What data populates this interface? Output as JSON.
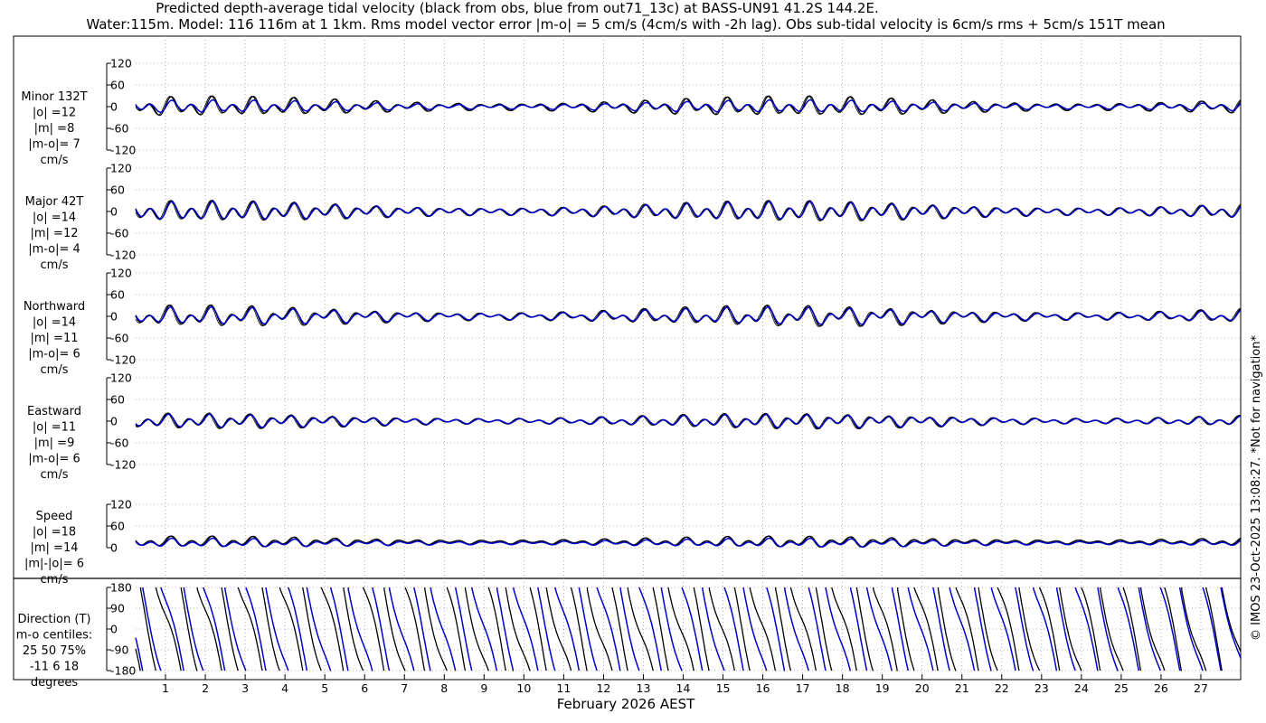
{
  "title_line1": "Predicted depth-average tidal velocity (black from obs, blue from out71_13c) at BASS-UN91 41.2S 144.2E.",
  "title_line2": "Water:115m. Model: 116 116m at 1 1km. Rms model vector error |m-o| = 5 cm/s (4cm/s with -2h lag). Obs sub-tidal velocity is 6cm/s rms + 5cm/s 151T mean",
  "copyright": "© IMOS 23-Oct-2025 13:08:27. *Not for navigation*",
  "colors": {
    "obs": "#000000",
    "model": "#0000cc",
    "grid": "#999999"
  },
  "chart_data": {
    "type": "line",
    "xlabel": "February 2026 AEST",
    "x_ticks": [
      "1",
      "2",
      "3",
      "4",
      "5",
      "6",
      "7",
      "8",
      "9",
      "10",
      "11",
      "12",
      "13",
      "14",
      "15",
      "16",
      "17",
      "18",
      "19",
      "20",
      "21",
      "22",
      "23",
      "24",
      "25",
      "26",
      "27"
    ],
    "xlim": [
      0.25,
      28.0
    ],
    "series_legend": [
      "obs (black)",
      "model (blue)"
    ],
    "panels": [
      {
        "id": "minor",
        "labels": [
          "Minor 132T",
          "|o| =12",
          "|m| =8",
          "|m-o|= 7",
          "cm/s"
        ],
        "yticks": [
          "120",
          "60",
          "0",
          "-60",
          "-120"
        ],
        "ylim": [
          -120,
          120
        ],
        "obs": {
          "mean": 0,
          "semidiurnal_amp": 16,
          "diurnal_amp": 11,
          "sd_phase": 0.4,
          "d_phase": 0.2
        },
        "model": {
          "mean": 0,
          "semidiurnal_amp": 11,
          "diurnal_amp": 6,
          "sd_phase": 0.2,
          "d_phase": 0.1
        }
      },
      {
        "id": "major",
        "labels": [
          "Major 42T",
          "|o| =14",
          "|m| =12",
          "|m-o|= 4",
          "cm/s"
        ],
        "yticks": [
          "120",
          "60",
          "0",
          "-60",
          "-120"
        ],
        "ylim": [
          -120,
          120
        ],
        "obs": {
          "mean": 0,
          "semidiurnal_amp": 18,
          "diurnal_amp": 10,
          "sd_phase": 0.3,
          "d_phase": 0.5
        },
        "model": {
          "mean": 0,
          "semidiurnal_amp": 16,
          "diurnal_amp": 9,
          "sd_phase": 0.15,
          "d_phase": 0.4
        }
      },
      {
        "id": "northward",
        "labels": [
          "Northward",
          "|o| =14",
          "|m| =11",
          "|m-o|= 6",
          "cm/s"
        ],
        "yticks": [
          "120",
          "60",
          "0",
          "-60",
          "-120"
        ],
        "ylim": [
          -120,
          120
        ],
        "obs": {
          "mean": 0,
          "semidiurnal_amp": 16,
          "diurnal_amp": 13,
          "sd_phase": 0.6,
          "d_phase": 0.9
        },
        "model": {
          "mean": 0,
          "semidiurnal_amp": 13,
          "diurnal_amp": 11,
          "sd_phase": 0.45,
          "d_phase": 0.8
        }
      },
      {
        "id": "eastward",
        "labels": [
          "Eastward",
          "|o| =11",
          "|m| =9",
          "|m-o|= 6",
          "cm/s"
        ],
        "yticks": [
          "120",
          "60",
          "0",
          "-60",
          "-120"
        ],
        "ylim": [
          -120,
          120
        ],
        "obs": {
          "mean": 0,
          "semidiurnal_amp": 13,
          "diurnal_amp": 8,
          "sd_phase": 1.1,
          "d_phase": 1.4
        },
        "model": {
          "mean": 0,
          "semidiurnal_amp": 11,
          "diurnal_amp": 7,
          "sd_phase": 0.95,
          "d_phase": 1.3
        }
      },
      {
        "id": "speed",
        "labels": [
          "Speed",
          "|o| =18",
          "|m| =14",
          "|m|-|o|= 6",
          "cm/s"
        ],
        "yticks": [
          "120",
          "60",
          "0"
        ],
        "ylim": [
          0,
          120
        ],
        "obs": {
          "mean": 16,
          "semidiurnal_amp": 9,
          "diurnal_amp": 6,
          "sd_phase": 0.2,
          "d_phase": 0.6
        },
        "model": {
          "mean": 13,
          "semidiurnal_amp": 7,
          "diurnal_amp": 5,
          "sd_phase": 0.1,
          "d_phase": 0.5
        }
      },
      {
        "id": "direction",
        "labels": [
          "Direction (T)",
          "m-o centiles:",
          "25  50  75%",
          "-11   6  18",
          "degrees"
        ],
        "yticks": [
          "180",
          "90",
          "0",
          "-90",
          "-180"
        ],
        "ylim": [
          -180,
          180
        ],
        "obs": {
          "start": 40,
          "rate_deg_per_day": -700,
          "wobble": 50
        },
        "model": {
          "start": 95,
          "rate_deg_per_day": -690,
          "wobble": 40
        }
      }
    ]
  }
}
